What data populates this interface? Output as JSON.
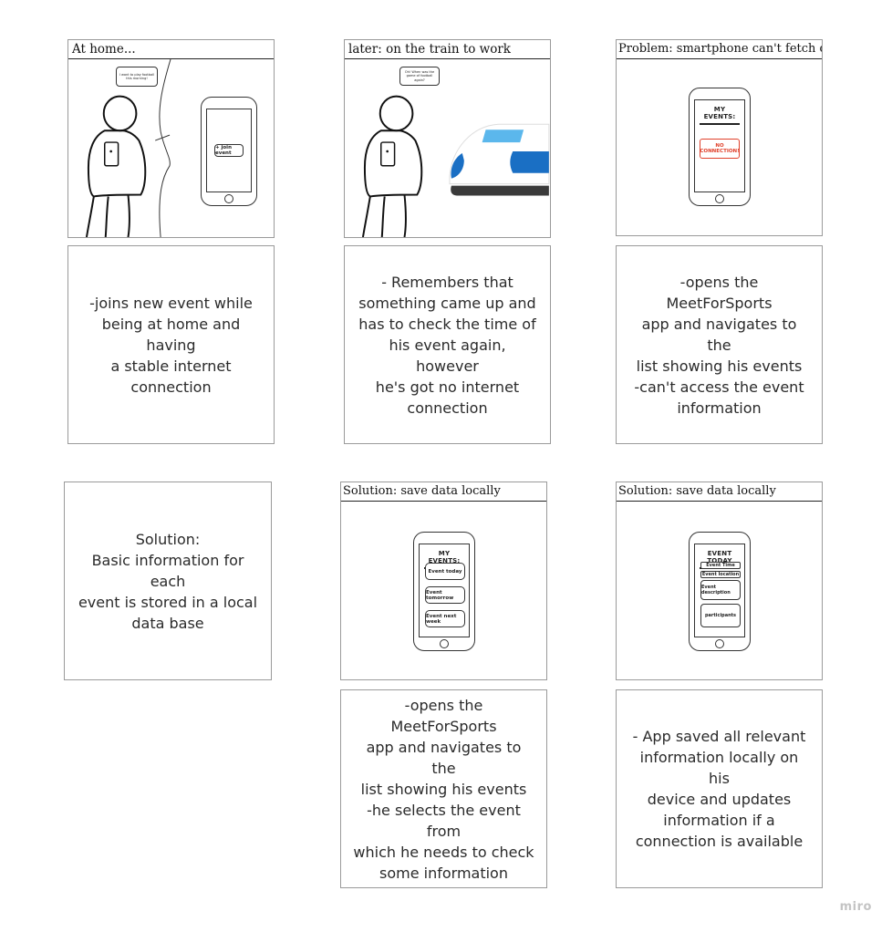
{
  "panels": {
    "p1": {
      "caption": "At home...",
      "bubble": "I want to play football this morning!",
      "phone_button": "+ join event"
    },
    "p2": {
      "caption": "later: on the train to work",
      "bubble": "Oh! When was the game of football again?"
    },
    "p3": {
      "caption": "Problem: smartphone can't fetch data",
      "phone_title": "MY EVENTS:",
      "error": "NO\nCONNECTION!"
    },
    "p5": {
      "caption": "Solution: save data locally",
      "phone_title": "MY EVENTS:",
      "events": [
        "Event today",
        "Event tomorrow",
        "Event next week"
      ]
    },
    "p6": {
      "caption": "Solution: save data locally",
      "phone_title": "EVENT TODAY",
      "fields": [
        "Event Time",
        "Event location",
        "Event description",
        "participants"
      ]
    }
  },
  "notes": {
    "n1": "-joins new event while\nbeing at home and having\na stable internet\nconnection",
    "n2": "- Remembers that\nsomething came up and\nhas to check the time of\nhis event again, however\nhe's got no internet\nconnection",
    "n3": "-opens the MeetForSports\napp and navigates to the\nlist showing his events\n-can't access the event\ninformation",
    "n4": "Solution:\nBasic information for each\nevent is stored in a local\ndata base",
    "n5": "-opens the MeetForSports\napp and navigates to the\nlist showing his events\n-he selects the event from\nwhich he needs to check\nsome information",
    "n6": "- App saved all relevant\ninformation locally on his\ndevice and updates\ninformation if a\nconnection is available"
  },
  "watermark": "miro",
  "colors": {
    "error_red": "#e0412b",
    "train_blue": "#1a6fc4",
    "train_light_blue": "#5bb7ec",
    "train_dark": "#3a3a3a"
  }
}
